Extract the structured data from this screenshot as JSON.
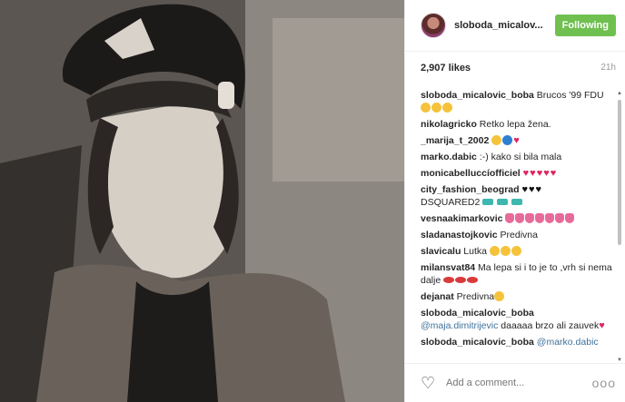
{
  "header": {
    "username": "sloboda_micalov...",
    "follow_label": "Following"
  },
  "meta": {
    "likes": "2,907 likes",
    "time": "21h"
  },
  "comments": [
    {
      "user": "sloboda_micalovic_boba",
      "text": " Brucos '99 FDU"
    },
    {
      "user": "nikolagricko",
      "text": " Retko lepa žena."
    },
    {
      "user": "_marija_t_2002",
      "text": ""
    },
    {
      "user": "marko.dabic",
      "text": " :-) kako si bila mala"
    },
    {
      "user": "monicabelluccíofficiel",
      "text": ""
    },
    {
      "user": "city_fashion_beograd",
      "text": " DSQUARED2"
    },
    {
      "user": "vesnaakimarkovic",
      "text": ""
    },
    {
      "user": "sladanastojkovic",
      "text": " Predivna"
    },
    {
      "user": "slavicalu",
      "text": " Lutka"
    },
    {
      "user": "milansvat84",
      "text": " Ma lepa si i to je to ,vrh si nema dalje"
    },
    {
      "user": "dejanat",
      "text": " Predivna"
    },
    {
      "user": "sloboda_micalovic_boba",
      "mention": "@maja.dimitrijevic",
      "text": " daaaaa brzo ali zauvek"
    },
    {
      "user": "sloboda_micalovic_boba",
      "mention": "@marko.dabic",
      "text": ""
    }
  ],
  "footer": {
    "placeholder": "Add a comment...",
    "more": "ooo"
  },
  "icons": [
    "heart-icon",
    "more-options-icon"
  ]
}
